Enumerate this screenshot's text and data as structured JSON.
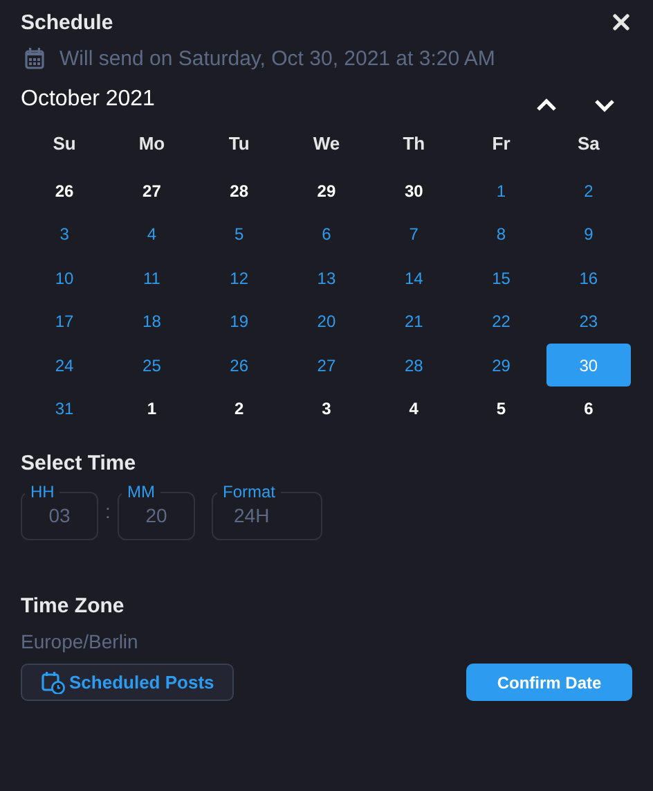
{
  "title": "Schedule",
  "summary": "Will send on Saturday, Oct 30, 2021 at 3:20 AM",
  "month": "October 2021",
  "weekdays": [
    "Su",
    "Mo",
    "Tu",
    "We",
    "Th",
    "Fr",
    "Sa"
  ],
  "days": [
    {
      "label": "26",
      "in_month": false,
      "selected": false
    },
    {
      "label": "27",
      "in_month": false,
      "selected": false
    },
    {
      "label": "28",
      "in_month": false,
      "selected": false
    },
    {
      "label": "29",
      "in_month": false,
      "selected": false
    },
    {
      "label": "30",
      "in_month": false,
      "selected": false
    },
    {
      "label": "1",
      "in_month": true,
      "selected": false
    },
    {
      "label": "2",
      "in_month": true,
      "selected": false
    },
    {
      "label": "3",
      "in_month": true,
      "selected": false
    },
    {
      "label": "4",
      "in_month": true,
      "selected": false
    },
    {
      "label": "5",
      "in_month": true,
      "selected": false
    },
    {
      "label": "6",
      "in_month": true,
      "selected": false
    },
    {
      "label": "7",
      "in_month": true,
      "selected": false
    },
    {
      "label": "8",
      "in_month": true,
      "selected": false
    },
    {
      "label": "9",
      "in_month": true,
      "selected": false
    },
    {
      "label": "10",
      "in_month": true,
      "selected": false
    },
    {
      "label": "11",
      "in_month": true,
      "selected": false
    },
    {
      "label": "12",
      "in_month": true,
      "selected": false
    },
    {
      "label": "13",
      "in_month": true,
      "selected": false
    },
    {
      "label": "14",
      "in_month": true,
      "selected": false
    },
    {
      "label": "15",
      "in_month": true,
      "selected": false
    },
    {
      "label": "16",
      "in_month": true,
      "selected": false
    },
    {
      "label": "17",
      "in_month": true,
      "selected": false
    },
    {
      "label": "18",
      "in_month": true,
      "selected": false
    },
    {
      "label": "19",
      "in_month": true,
      "selected": false
    },
    {
      "label": "20",
      "in_month": true,
      "selected": false
    },
    {
      "label": "21",
      "in_month": true,
      "selected": false
    },
    {
      "label": "22",
      "in_month": true,
      "selected": false
    },
    {
      "label": "23",
      "in_month": true,
      "selected": false
    },
    {
      "label": "24",
      "in_month": true,
      "selected": false
    },
    {
      "label": "25",
      "in_month": true,
      "selected": false
    },
    {
      "label": "26",
      "in_month": true,
      "selected": false
    },
    {
      "label": "27",
      "in_month": true,
      "selected": false
    },
    {
      "label": "28",
      "in_month": true,
      "selected": false
    },
    {
      "label": "29",
      "in_month": true,
      "selected": false
    },
    {
      "label": "30",
      "in_month": true,
      "selected": true
    },
    {
      "label": "31",
      "in_month": true,
      "selected": false
    },
    {
      "label": "1",
      "in_month": false,
      "selected": false
    },
    {
      "label": "2",
      "in_month": false,
      "selected": false
    },
    {
      "label": "3",
      "in_month": false,
      "selected": false
    },
    {
      "label": "4",
      "in_month": false,
      "selected": false
    },
    {
      "label": "5",
      "in_month": false,
      "selected": false
    },
    {
      "label": "6",
      "in_month": false,
      "selected": false
    }
  ],
  "time": {
    "heading": "Select Time",
    "fields": [
      {
        "label": "HH",
        "value": "03"
      },
      {
        "label": "MM",
        "value": "20"
      }
    ],
    "separator": ":",
    "format": {
      "label": "Format",
      "value": "24H"
    }
  },
  "timezone": {
    "heading": "Time Zone",
    "value": "Europe/Berlin"
  },
  "buttons": {
    "secondary": "Scheduled Posts",
    "primary": "Confirm Date"
  }
}
